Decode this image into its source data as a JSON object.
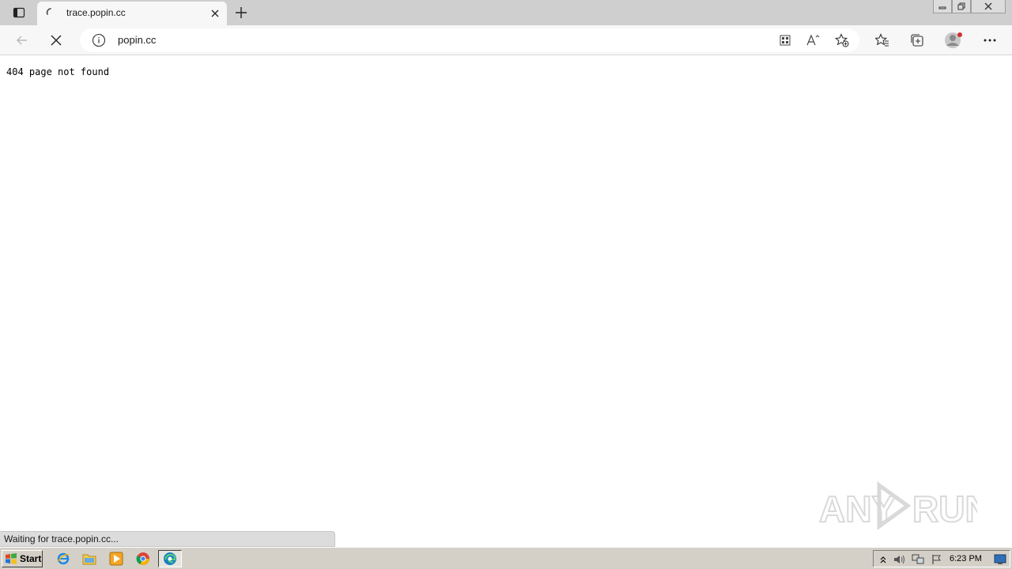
{
  "browser": {
    "tab": {
      "title": "trace.popin.cc"
    },
    "address_bar": {
      "url": "popin.cc"
    },
    "status_text": "Waiting for trace.popin.cc..."
  },
  "page": {
    "body_text": "404 page not found"
  },
  "watermark": {
    "text": "ANY RUN"
  },
  "taskbar": {
    "start_label": "Start",
    "clock": "6:23 PM"
  },
  "icons": {
    "tab_actions": "tab-actions-icon",
    "spinner": "loading-spinner-icon",
    "close_tab": "close-icon",
    "new_tab": "plus-icon",
    "back": "back-arrow-icon",
    "stop": "stop-icon",
    "info": "info-icon",
    "apps": "apps-icon",
    "read_aloud": "read-aloud-icon",
    "add_favorite": "add-favorite-icon",
    "favorites": "favorites-icon",
    "collections": "collections-icon",
    "profile": "profile-icon",
    "more": "more-icon"
  },
  "colors": {
    "tabstrip": "#cfcfcf",
    "toolbar": "#f7f7f7",
    "taskbar": "#d4d0c8",
    "profile_dot": "#d32f2f"
  }
}
